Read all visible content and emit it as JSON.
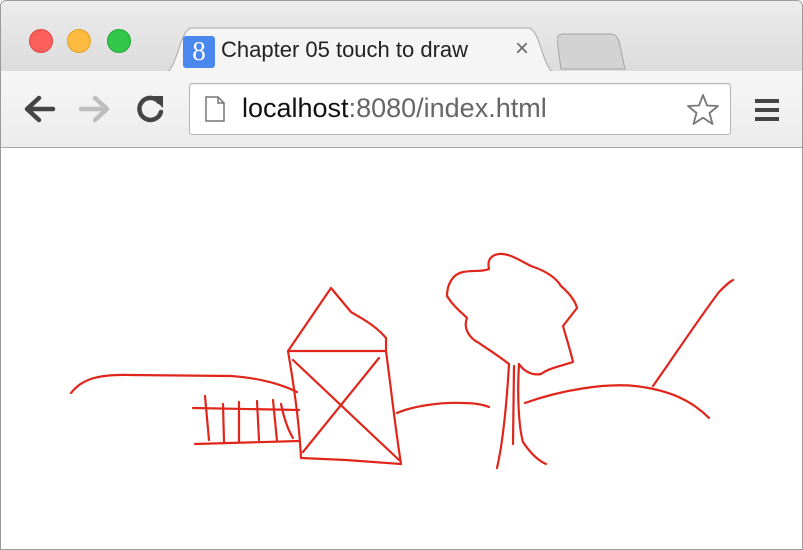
{
  "window": {
    "controls": [
      "close",
      "minimize",
      "maximize"
    ]
  },
  "tab": {
    "favicon_letter": "8",
    "title": "Chapter 05 touch to draw",
    "close_glyph": "×"
  },
  "toolbar": {
    "back_icon": "arrow-left-icon",
    "forward_icon": "arrow-right-icon",
    "reload_icon": "reload-icon",
    "menu_icon": "hamburger-menu-icon"
  },
  "omnibox": {
    "url_host": "localhost",
    "url_rest": ":8080/index.html"
  },
  "canvas": {
    "stroke_color": "#e0261b",
    "description_strokes": [
      "hill-left",
      "fence",
      "house",
      "hill-middle",
      "tree",
      "hill-right"
    ]
  }
}
